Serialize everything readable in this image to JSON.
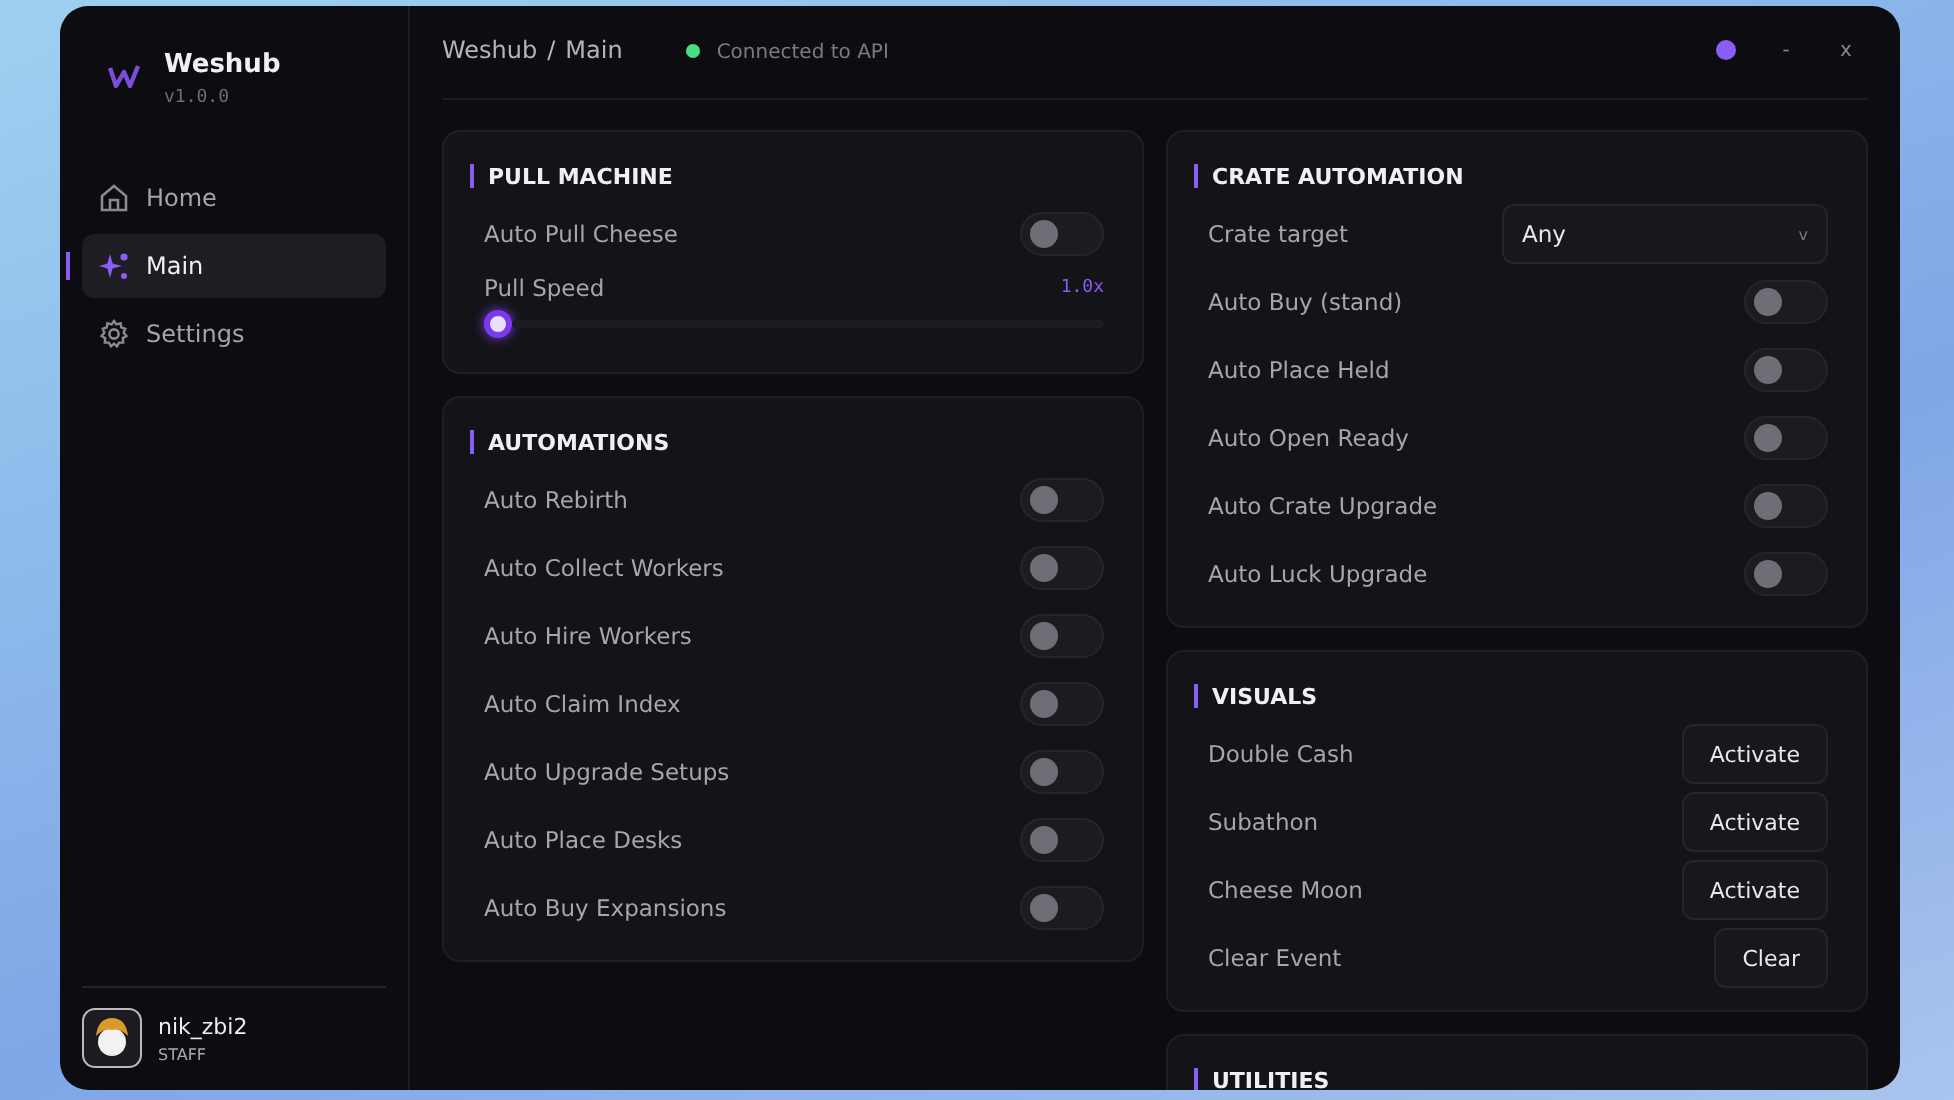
{
  "app": {
    "name": "Weshub",
    "version": "v1.0.0"
  },
  "sidebar": {
    "items": [
      {
        "label": "Home",
        "kind": "home",
        "selected": false
      },
      {
        "label": "Main",
        "kind": "main",
        "selected": true
      },
      {
        "label": "Settings",
        "kind": "settings",
        "selected": false
      }
    ]
  },
  "user": {
    "name": "nik_zbi2",
    "role": "STAFF"
  },
  "header": {
    "breadcrumb": [
      "Weshub",
      "Main"
    ],
    "separator": "/",
    "status": "Connected to API",
    "connected": true,
    "minimize": "-",
    "close": "x"
  },
  "columns": [
    [
      {
        "title": "PULL MACHINE",
        "rows": [
          {
            "kind": "toggle",
            "label": "Auto Pull Cheese",
            "on": false
          },
          {
            "kind": "slider",
            "label": "Pull Speed",
            "reading": "1.0x",
            "level": 0
          }
        ]
      },
      {
        "title": "AUTOMATIONS",
        "rows": [
          {
            "kind": "toggle",
            "label": "Auto Rebirth",
            "on": false
          },
          {
            "kind": "toggle",
            "label": "Auto Collect Workers",
            "on": false
          },
          {
            "kind": "toggle",
            "label": "Auto Hire Workers",
            "on": false
          },
          {
            "kind": "toggle",
            "label": "Auto Claim Index",
            "on": false
          },
          {
            "kind": "toggle",
            "label": "Auto Upgrade Setups",
            "on": false
          },
          {
            "kind": "toggle",
            "label": "Auto Place Desks",
            "on": false
          },
          {
            "kind": "toggle",
            "label": "Auto Buy Expansions",
            "on": false
          }
        ]
      }
    ],
    [
      {
        "title": "CRATE AUTOMATION",
        "rows": [
          {
            "kind": "dropdown",
            "label": "Crate target",
            "value": "Any",
            "caret": "v"
          },
          {
            "kind": "toggle",
            "label": "Auto Buy (stand)",
            "on": false
          },
          {
            "kind": "toggle",
            "label": "Auto Place Held",
            "on": false
          },
          {
            "kind": "toggle",
            "label": "Auto Open Ready",
            "on": false
          },
          {
            "kind": "toggle",
            "label": "Auto Crate Upgrade",
            "on": false
          },
          {
            "kind": "toggle",
            "label": "Auto Luck Upgrade",
            "on": false
          }
        ]
      },
      {
        "title": "VISUALS",
        "rows": [
          {
            "kind": "button",
            "label": "Double Cash",
            "button": "Activate"
          },
          {
            "kind": "button",
            "label": "Subathon",
            "button": "Activate"
          },
          {
            "kind": "button",
            "label": "Cheese Moon",
            "button": "Activate"
          },
          {
            "kind": "button",
            "label": "Clear Event",
            "button": "Clear"
          }
        ]
      },
      {
        "title": "UTILITIES"
      }
    ]
  ]
}
